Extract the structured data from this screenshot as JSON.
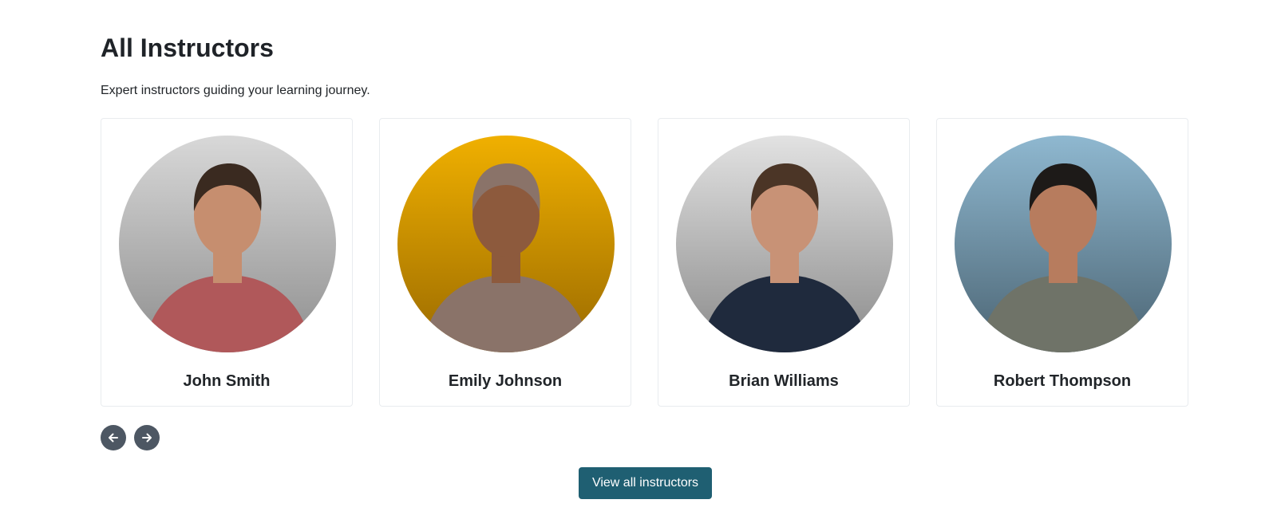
{
  "section": {
    "title": "All Instructors",
    "subtitle": "Expert instructors guiding your learning journey."
  },
  "instructors": [
    {
      "name": "John Smith",
      "photo_alt": "John Smith",
      "bg_top": "#d8d8d8",
      "bg_bottom": "#8e8e8e",
      "skin": "#c68e6f",
      "hair": "#3a2a20",
      "shirt": "#b0585a"
    },
    {
      "name": "Emily Johnson",
      "photo_alt": "Emily Johnson",
      "bg_top": "#f0b000",
      "bg_bottom": "#9a6a00",
      "skin": "#8d5a3d",
      "hair": "#8a7369",
      "shirt": "#8a7369"
    },
    {
      "name": "Brian Williams",
      "photo_alt": "Brian Williams",
      "bg_top": "#e2e2e2",
      "bg_bottom": "#8a8a8a",
      "skin": "#c89276",
      "hair": "#4b3526",
      "shirt": "#1f2a3d"
    },
    {
      "name": "Robert Thompson",
      "photo_alt": "Robert Thompson",
      "bg_top": "#8fb8d0",
      "bg_bottom": "#4b6473",
      "skin": "#b77c5e",
      "hair": "#1d1a18",
      "shirt": "#6f7368"
    }
  ],
  "carousel": {
    "prev_icon": "arrow-left-icon",
    "next_icon": "arrow-right-icon"
  },
  "cta": {
    "label": "View all instructors",
    "color": "#1f5f72"
  }
}
